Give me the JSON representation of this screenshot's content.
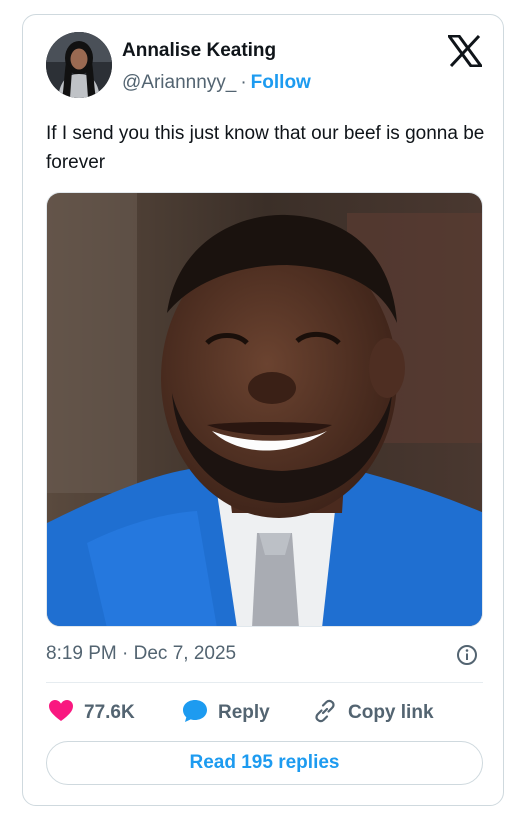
{
  "author": {
    "name": "Annalise Keating",
    "handle": "@Ariannnyy_",
    "separator": "·",
    "follow_label": "Follow",
    "avatar_icon": "profile-photo"
  },
  "platform_icon": "x-logo-icon",
  "tweet": {
    "text": "If I send you this just know that our beef is gonna be forever",
    "media_description_icon": "photo"
  },
  "meta": {
    "timestamp": "8:19 PM · Dec 7, 2025"
  },
  "actions": {
    "likes_count": "77.6K",
    "reply_label": "Reply",
    "copy_label": "Copy link"
  },
  "read_replies_label": "Read 195 replies",
  "colors": {
    "accent": "#1d9bf0",
    "like": "#f91880",
    "muted": "#536471",
    "text": "#0f1419"
  }
}
